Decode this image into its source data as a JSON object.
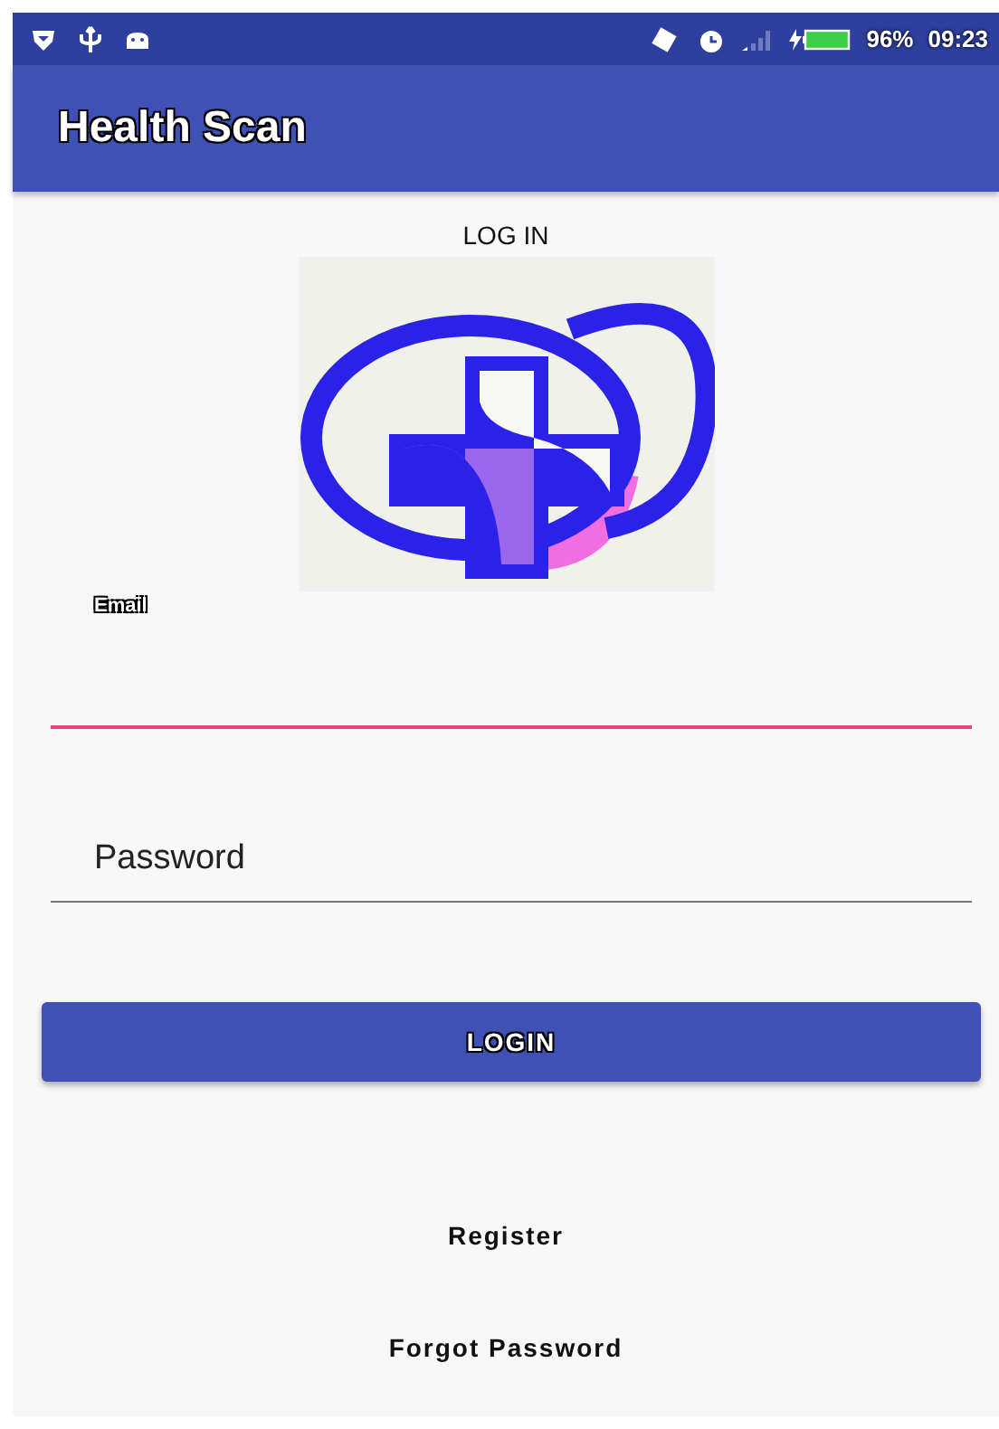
{
  "status_bar": {
    "battery": "96%",
    "time": "09:23"
  },
  "app_bar": {
    "title": "Health Scan"
  },
  "heading": "LOG IN",
  "fields": [
    {
      "placeholder": "Email",
      "focused": true
    },
    {
      "placeholder": "Password",
      "focused": false
    }
  ],
  "login_button": "LOGIN",
  "links": [
    "Register",
    "Forgot Password"
  ]
}
